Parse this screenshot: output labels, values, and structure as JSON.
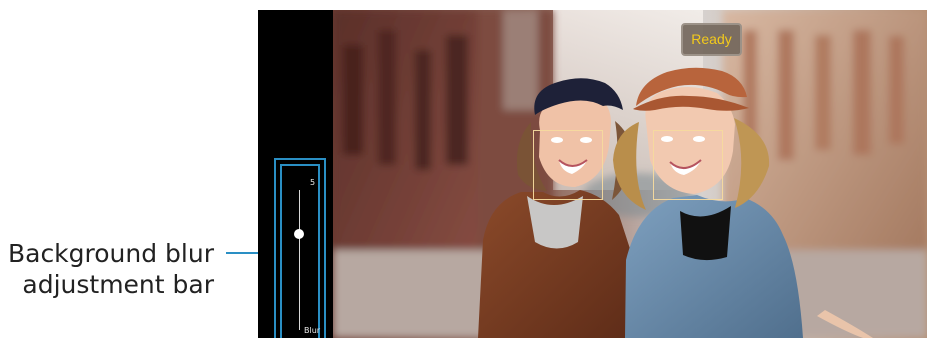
{
  "callout": {
    "line1": "Background blur",
    "line2": "adjustment bar"
  },
  "camera": {
    "status": "Ready"
  },
  "blur_control": {
    "value": "5",
    "label": "Blur",
    "level_fraction": 0.7
  },
  "colors": {
    "callout_blue": "#2a8fc4",
    "status_text": "#f3ca1c"
  }
}
